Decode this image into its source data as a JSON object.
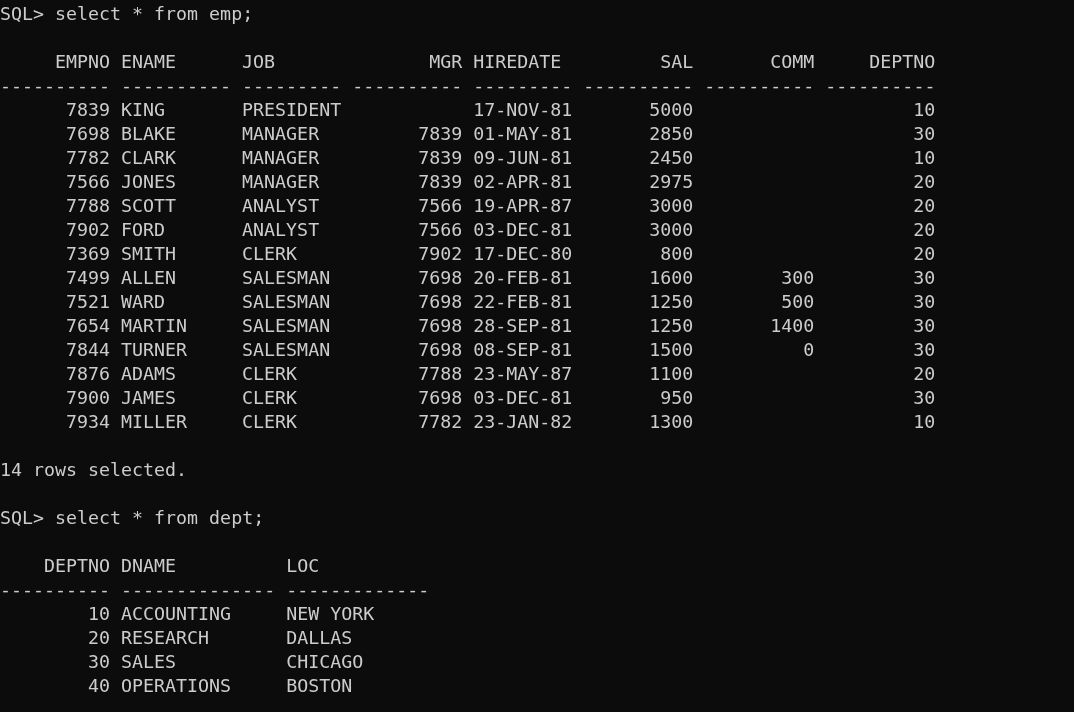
{
  "blocks": [
    {
      "kind": "prompt",
      "prompt": "SQL>",
      "command": "select * from emp;"
    },
    {
      "kind": "table",
      "columns": [
        {
          "heading": "EMPNO",
          "rule": "----------",
          "numeric": true
        },
        {
          "heading": "ENAME",
          "rule": "----------",
          "numeric": false
        },
        {
          "heading": "JOB",
          "rule": "---------",
          "numeric": false
        },
        {
          "heading": "MGR",
          "rule": "----------",
          "numeric": true
        },
        {
          "heading": "HIREDATE",
          "rule": "---------",
          "numeric": false
        },
        {
          "heading": "SAL",
          "rule": "----------",
          "numeric": true
        },
        {
          "heading": "COMM",
          "rule": "----------",
          "numeric": true
        },
        {
          "heading": "DEPTNO",
          "rule": "----------",
          "numeric": true
        }
      ],
      "rows": [
        [
          "7839",
          "KING",
          "PRESIDENT",
          null,
          "17-NOV-81",
          "5000",
          null,
          "10"
        ],
        [
          "7698",
          "BLAKE",
          "MANAGER",
          "7839",
          "01-MAY-81",
          "2850",
          null,
          "30"
        ],
        [
          "7782",
          "CLARK",
          "MANAGER",
          "7839",
          "09-JUN-81",
          "2450",
          null,
          "10"
        ],
        [
          "7566",
          "JONES",
          "MANAGER",
          "7839",
          "02-APR-81",
          "2975",
          null,
          "20"
        ],
        [
          "7788",
          "SCOTT",
          "ANALYST",
          "7566",
          "19-APR-87",
          "3000",
          null,
          "20"
        ],
        [
          "7902",
          "FORD",
          "ANALYST",
          "7566",
          "03-DEC-81",
          "3000",
          null,
          "20"
        ],
        [
          "7369",
          "SMITH",
          "CLERK",
          "7902",
          "17-DEC-80",
          "800",
          null,
          "20"
        ],
        [
          "7499",
          "ALLEN",
          "SALESMAN",
          "7698",
          "20-FEB-81",
          "1600",
          "300",
          "30"
        ],
        [
          "7521",
          "WARD",
          "SALESMAN",
          "7698",
          "22-FEB-81",
          "1250",
          "500",
          "30"
        ],
        [
          "7654",
          "MARTIN",
          "SALESMAN",
          "7698",
          "28-SEP-81",
          "1250",
          "1400",
          "30"
        ],
        [
          "7844",
          "TURNER",
          "SALESMAN",
          "7698",
          "08-SEP-81",
          "1500",
          "0",
          "30"
        ],
        [
          "7876",
          "ADAMS",
          "CLERK",
          "7788",
          "23-MAY-87",
          "1100",
          null,
          "20"
        ],
        [
          "7900",
          "JAMES",
          "CLERK",
          "7698",
          "03-DEC-81",
          "950",
          null,
          "30"
        ],
        [
          "7934",
          "MILLER",
          "CLERK",
          "7782",
          "23-JAN-82",
          "1300",
          null,
          "10"
        ]
      ]
    },
    {
      "kind": "message",
      "text": "14 rows selected."
    },
    {
      "kind": "prompt",
      "prompt": "SQL>",
      "command": "select * from dept;"
    },
    {
      "kind": "table",
      "columns": [
        {
          "heading": "DEPTNO",
          "rule": "----------",
          "numeric": true
        },
        {
          "heading": "DNAME",
          "rule": "--------------",
          "numeric": false
        },
        {
          "heading": "LOC",
          "rule": "-------------",
          "numeric": false
        }
      ],
      "rows": [
        [
          "10",
          "ACCOUNTING",
          "NEW YORK"
        ],
        [
          "20",
          "RESEARCH",
          "DALLAS"
        ],
        [
          "30",
          "SALES",
          "CHICAGO"
        ],
        [
          "40",
          "OPERATIONS",
          "BOSTON"
        ]
      ]
    }
  ]
}
